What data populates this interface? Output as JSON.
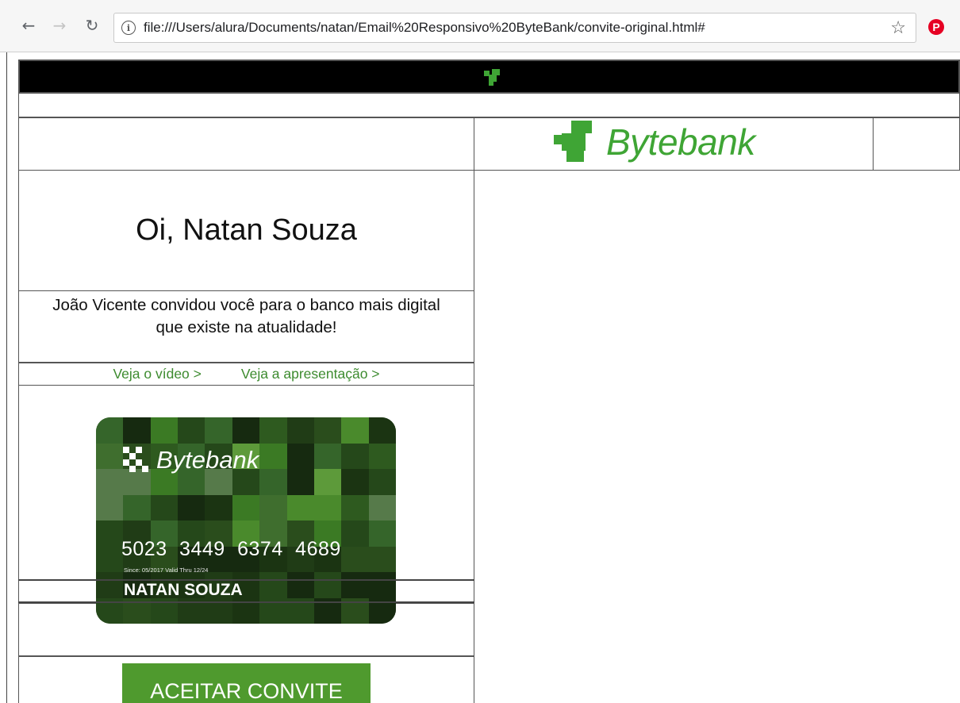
{
  "browser": {
    "back_icon": "arrow-left-icon",
    "forward_icon": "arrow-right-icon",
    "reload_icon": "reload-icon",
    "info_icon": "info-icon",
    "url": "file:///Users/alura/Documents/natan/Email%20Responsivo%20ByteBank/convite-original.html#",
    "bookmark_icon": "star-icon",
    "extension_icon": "pinterest-icon"
  },
  "email": {
    "brand_name": "Bytebank",
    "brand_color": "#3fa535",
    "greeting": "Oi, Natan Souza",
    "invite_line1": "João Vicente convidou você para o banco mais digital",
    "invite_line2": "que existe na atualidade!",
    "links": {
      "video": "Veja o vídeo >",
      "presentation": "Veja a apresentação >"
    },
    "card": {
      "brand": "Bytebank",
      "number": "5023 3449 6374 4689",
      "dates": "Since: 05/2017  Valid Thru 12/24",
      "holder": "NATAN SOUZA"
    },
    "cta_label": "ACEITAR CONVITE",
    "cta_color": "#4f9a2e"
  }
}
